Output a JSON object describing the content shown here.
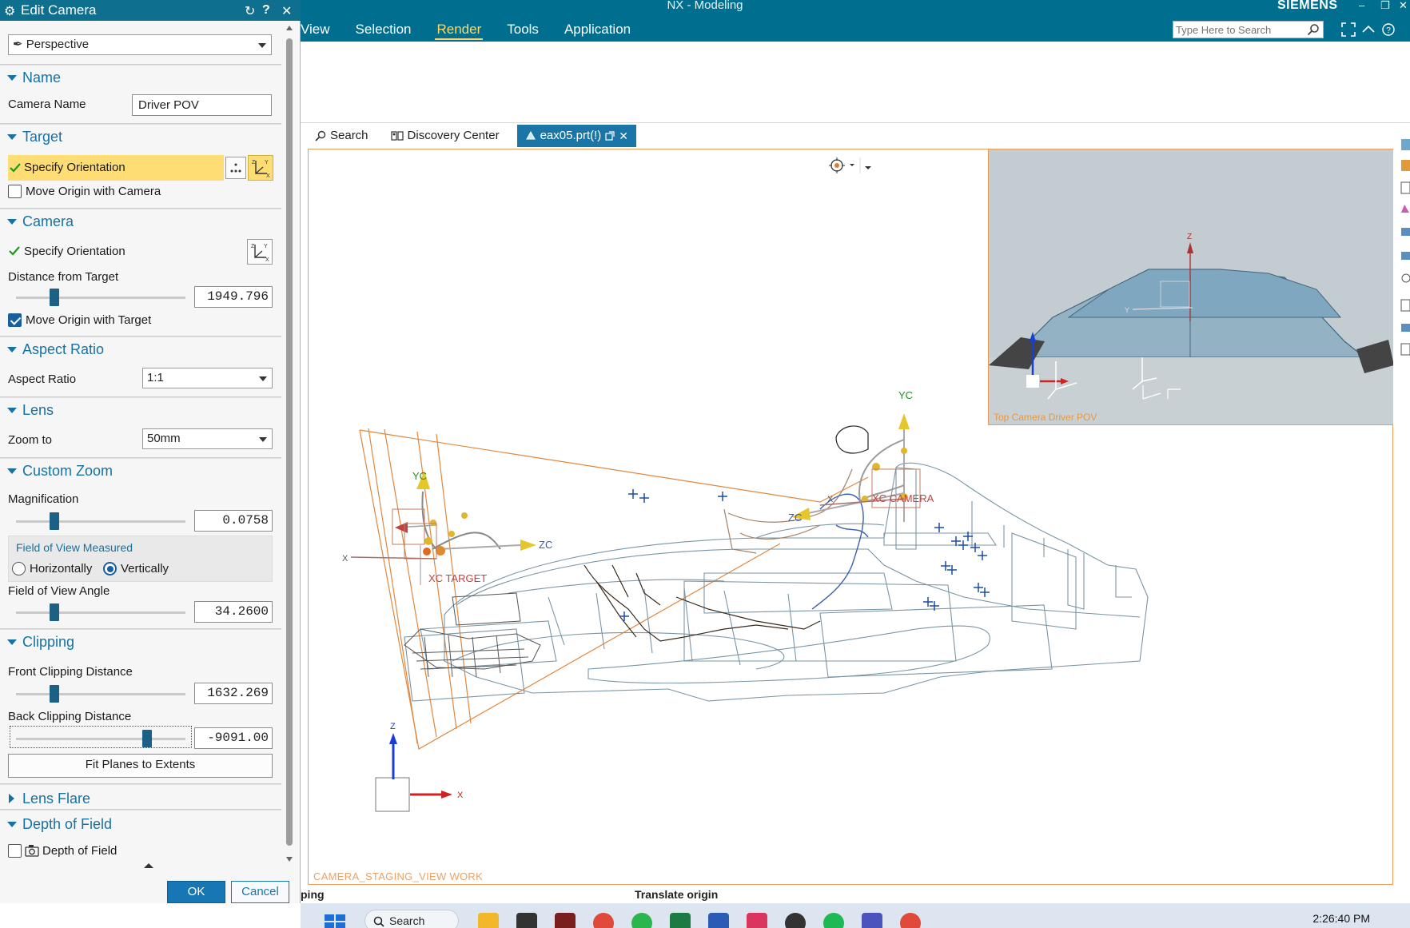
{
  "app": {
    "window_title": "NX - Modeling",
    "brand": "SIEMENS",
    "menu": [
      "View",
      "Selection",
      "Render",
      "Tools",
      "Application"
    ],
    "active_menu": "Render",
    "search_placeholder": "Type Here to Search"
  },
  "doc_tabs": {
    "search": "Search",
    "discovery": "Discovery Center",
    "part": "eax05.prt(!)"
  },
  "viewport": {
    "view_label": "CAMERA_STAGING_VIEW WORK",
    "inset_label": "Top Camera Driver POV",
    "axis_labels": {
      "target_yc": "YC",
      "target_zc": "ZC",
      "target_name": "XC TARGET",
      "camera_yc": "YC",
      "camera_zc": "ZC",
      "camera_name": "XC CAMERA",
      "triad_z": "Z",
      "triad_x": "X"
    }
  },
  "status": {
    "left": "ping",
    "center": "Translate origin"
  },
  "taskbar": {
    "search": "Search",
    "clock": "2:26:40 PM"
  },
  "dialog": {
    "title": "Edit Camera",
    "projection": "Perspective",
    "sections": {
      "name": "Name",
      "target": "Target",
      "camera": "Camera",
      "aspect_ratio": "Aspect Ratio",
      "lens": "Lens",
      "custom_zoom": "Custom Zoom",
      "clipping": "Clipping",
      "lens_flare": "Lens Flare",
      "depth_of_field": "Depth of Field"
    },
    "camera_name_label": "Camera Name",
    "camera_name_value": "Driver POV",
    "target_specify_orientation": "Specify Orientation",
    "move_origin_with_camera": "Move Origin with Camera",
    "move_origin_with_camera_checked": false,
    "camera_specify_orientation": "Specify Orientation",
    "distance_from_target_label": "Distance from Target",
    "distance_from_target_value": "1949.796",
    "distance_slider_fraction": 0.21,
    "move_origin_with_target": "Move Origin with Target",
    "move_origin_with_target_checked": true,
    "aspect_ratio_label": "Aspect Ratio",
    "aspect_ratio_value": "1:1",
    "zoom_to_label": "Zoom to",
    "zoom_to_value": "50mm",
    "magnification_label": "Magnification",
    "magnification_value": "0.0758",
    "magnification_slider_fraction": 0.21,
    "fov_measured_label": "Field of View Measured",
    "fov_horizontally": "Horizontally",
    "fov_vertically": "Vertically",
    "fov_selected": "Vertically",
    "fov_angle_label": "Field of View Angle",
    "fov_angle_value": "34.2600",
    "fov_slider_fraction": 0.21,
    "front_clip_label": "Front Clipping Distance",
    "front_clip_value": "1632.269",
    "front_clip_slider_fraction": 0.21,
    "back_clip_label": "Back Clipping Distance",
    "back_clip_value": "-9091.00",
    "back_clip_slider_fraction": 0.79,
    "fit_planes_button": "Fit Planes to Extents",
    "depth_of_field_checkbox": "Depth of Field",
    "ok_button": "OK",
    "cancel_button": "Cancel"
  }
}
